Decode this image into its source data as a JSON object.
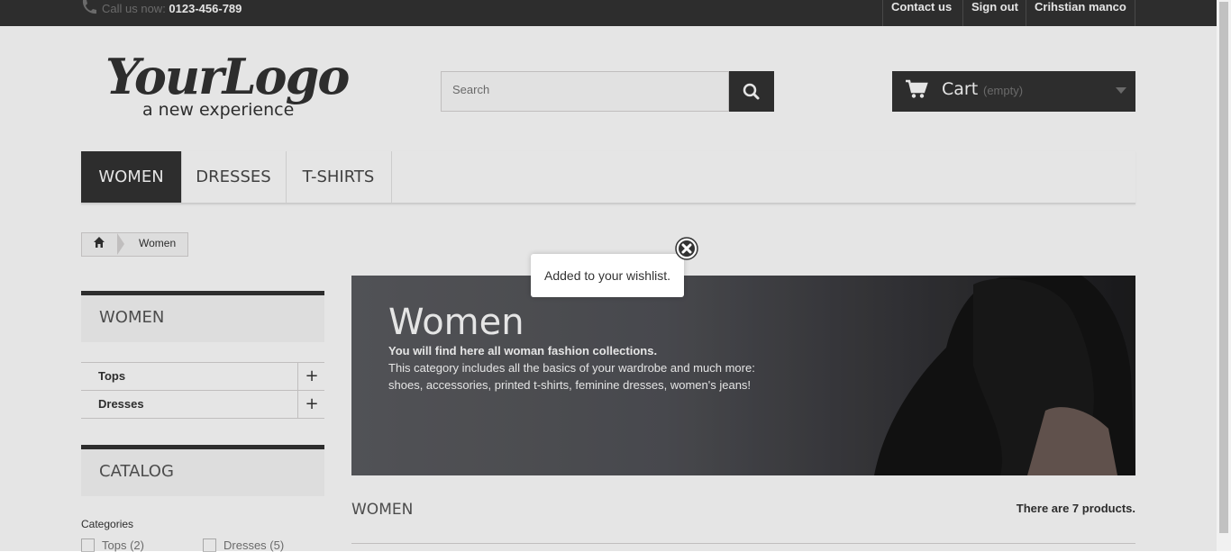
{
  "topbar": {
    "call_label": "Call us now: ",
    "phone": "0123-456-789",
    "links": [
      "Contact us",
      "Sign out",
      "Crihstian manco"
    ]
  },
  "header": {
    "logo_main": "YourLogo",
    "logo_sub": "a new experience",
    "search_placeholder": "Search",
    "cart_label": "Cart",
    "cart_status": "(empty)"
  },
  "menu": {
    "items": [
      "WOMEN",
      "DRESSES",
      "T-SHIRTS"
    ],
    "active_index": 0
  },
  "breadcrumb": {
    "current": "Women"
  },
  "sidebar": {
    "women_block": {
      "title": "WOMEN",
      "categories": [
        "Tops",
        "Dresses"
      ]
    },
    "catalog_block": {
      "title": "CATALOG",
      "filter_title": "Categories",
      "options": [
        "Tops (2)",
        "Dresses (5)"
      ]
    }
  },
  "banner": {
    "title": "Women",
    "lines": [
      "You will find here all woman fashion collections.",
      "This category includes all the basics of your wardrobe and much more:",
      "shoes, accessories, printed t-shirts, feminine dresses, women's jeans!"
    ]
  },
  "content": {
    "heading": "WOMEN",
    "product_count": "There are 7 products."
  },
  "popup": {
    "message": "Added to your wishlist."
  },
  "colors": {
    "dark": "#333333",
    "border": "#d6d4d4"
  }
}
